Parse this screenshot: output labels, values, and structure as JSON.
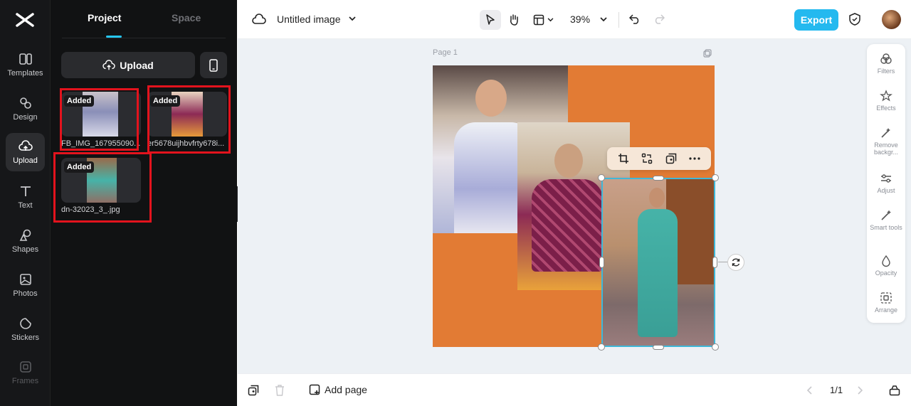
{
  "rail": {
    "items": [
      {
        "label": "Templates",
        "icon": "templates-icon"
      },
      {
        "label": "Design",
        "icon": "design-icon"
      },
      {
        "label": "Upload",
        "icon": "upload-cloud-icon"
      },
      {
        "label": "Text",
        "icon": "text-icon"
      },
      {
        "label": "Shapes",
        "icon": "shapes-icon"
      },
      {
        "label": "Photos",
        "icon": "photos-icon"
      },
      {
        "label": "Stickers",
        "icon": "stickers-icon"
      },
      {
        "label": "Frames",
        "icon": "frames-icon"
      }
    ],
    "active": "Upload"
  },
  "panel": {
    "tabs": [
      "Project",
      "Space"
    ],
    "active_tab": "Project",
    "upload_label": "Upload",
    "assets": [
      {
        "badge": "Added",
        "name": "FB_IMG_167955090..."
      },
      {
        "badge": "Added",
        "name": "er5678uijhbvfrty678i..."
      },
      {
        "badge": "Added",
        "name": "dn-32023_3_.jpg"
      }
    ]
  },
  "topbar": {
    "title": "Untitled image",
    "zoom": "39%",
    "export_label": "Export"
  },
  "canvas": {
    "page_label": "Page 1",
    "background_color": "#e27b34"
  },
  "right_tools": [
    {
      "label": "Filters",
      "icon": "filters-icon"
    },
    {
      "label": "Effects",
      "icon": "effects-icon"
    },
    {
      "label": "Remove backgr...",
      "icon": "remove-background-icon"
    },
    {
      "label": "Adjust",
      "icon": "adjust-icon"
    },
    {
      "label": "Smart tools",
      "icon": "smart-tools-icon"
    },
    {
      "label": "Opacity",
      "icon": "opacity-icon"
    },
    {
      "label": "Arrange",
      "icon": "arrange-icon"
    }
  ],
  "bottombar": {
    "add_page_label": "Add page",
    "page_indicator": "1/1"
  },
  "colors": {
    "accent": "#24b9ef",
    "highlight": "#e3131d",
    "selection": "#3fb8d8"
  }
}
